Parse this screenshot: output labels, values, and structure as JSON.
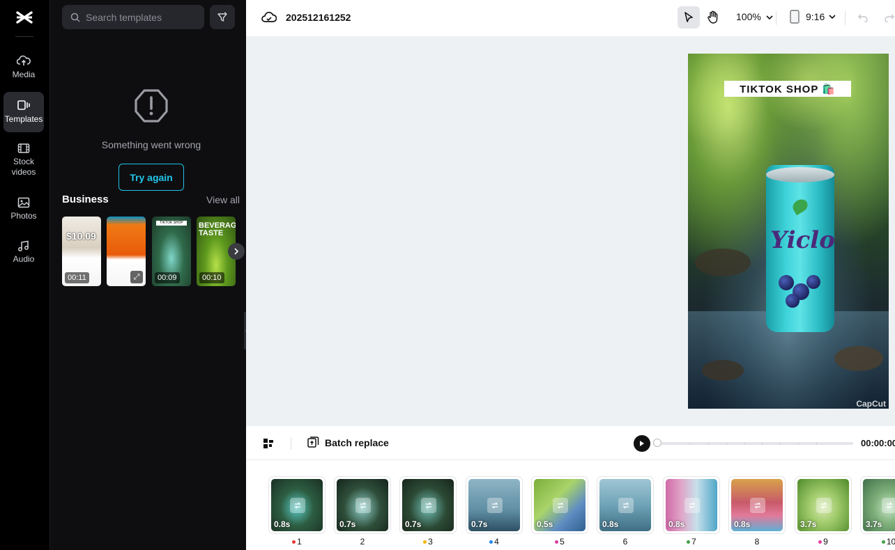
{
  "rail": {
    "items": [
      {
        "label": "Media",
        "icon": "cloud-upload-icon"
      },
      {
        "label": "Templates",
        "icon": "templates-icon",
        "active": true
      },
      {
        "label": "Stock videos",
        "icon": "film-icon"
      },
      {
        "label": "Photos",
        "icon": "image-icon"
      },
      {
        "label": "Audio",
        "icon": "music-icon"
      }
    ]
  },
  "panel": {
    "search_placeholder": "Search templates",
    "error_message": "Something went wrong",
    "try_again": "Try again",
    "section_title": "Business",
    "view_all": "View all",
    "templates": [
      {
        "duration": "00:11",
        "overlay_text": "$10.09"
      },
      {
        "duration": "",
        "overlay_text": ""
      },
      {
        "duration": "00:09",
        "overlay_text": "TIKTOK SHOP"
      },
      {
        "duration": "00:10",
        "overlay_text": "BEVERAG TASTE"
      }
    ]
  },
  "topbar": {
    "project_name": "202512161252",
    "zoom": "100%",
    "ratio": "9:16"
  },
  "preview": {
    "banner": "TIKTOK SHOP 🛍️",
    "can_text": "Yiclo",
    "watermark": "CapCut"
  },
  "controls": {
    "batch_replace": "Batch replace",
    "timecode": "00:00:00"
  },
  "timeline": {
    "clips": [
      {
        "duration": "0.8s",
        "number": "1",
        "dot": "#e53935"
      },
      {
        "duration": "0.7s",
        "number": "2",
        "dot": ""
      },
      {
        "duration": "0.7s",
        "number": "3",
        "dot": "#f5b400"
      },
      {
        "duration": "0.7s",
        "number": "4",
        "dot": "#1e88e5"
      },
      {
        "duration": "0.5s",
        "number": "5",
        "dot": "#e040a0"
      },
      {
        "duration": "0.8s",
        "number": "6",
        "dot": ""
      },
      {
        "duration": "0.8s",
        "number": "7",
        "dot": "#43a047"
      },
      {
        "duration": "0.8s",
        "number": "8",
        "dot": ""
      },
      {
        "duration": "3.7s",
        "number": "9",
        "dot": "#e040a0"
      },
      {
        "duration": "3.7s",
        "number": "10",
        "dot": "#43a047"
      }
    ]
  }
}
